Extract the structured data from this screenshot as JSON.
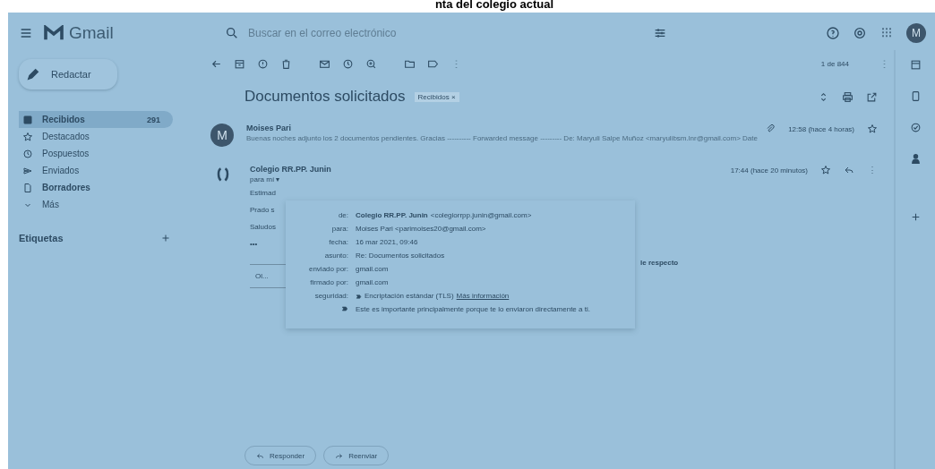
{
  "caption": "nta del colegio actual",
  "topbar": {
    "product": "Gmail",
    "search_placeholder": "Buscar en el correo electrónico",
    "avatar": "M"
  },
  "sidebar": {
    "compose": "Redactar",
    "items": [
      {
        "label": "Recibidos",
        "count": "291",
        "bold": true,
        "selected": true
      },
      {
        "label": "Destacados",
        "bold": false,
        "selected": false
      },
      {
        "label": "Pospuestos",
        "bold": false,
        "selected": false
      },
      {
        "label": "Enviados",
        "bold": false,
        "selected": false
      },
      {
        "label": "Borradores",
        "bold": true,
        "selected": false
      },
      {
        "label": "Más",
        "bold": false,
        "selected": false
      }
    ],
    "labels_heading": "Etiquetas"
  },
  "toolbar": {
    "pager": "1 de 844"
  },
  "thread": {
    "subject": "Documentos solicitados",
    "chip": "Recibidos ×",
    "messages": [
      {
        "kind": "letter",
        "avatar": "M",
        "sender": "Moises Pari",
        "snippet": "Buenas noches adjunto los 2 documentos pendientes. Gracias ---------- Forwarded message --------- De: Maryuli Salpe Muñoz <maryulibsm.lnr@gmail.com> Date",
        "time": "12:58 (hace 4 horas)",
        "attachment": true,
        "expanded": false
      },
      {
        "kind": "crest",
        "sender": "Colegio RR.PP. Junin",
        "to": "para mí ▾",
        "time": "17:44 (hace 20 minutos)",
        "attachment": false,
        "expanded": true,
        "body": [
          "Estimad",
          "Prado s",
          "Saludos",
          "•••"
        ],
        "aside": "le respecto",
        "file": "Ol..."
      }
    ]
  },
  "details": [
    {
      "label": "de:",
      "value": "**Colegio RR.PP. Junin** <colegiorrpp.junin@gmail.com>"
    },
    {
      "label": "para:",
      "value": "Moises Pari <parimoises20@gmail.com>"
    },
    {
      "label": "fecha:",
      "value": "16 mar 2021, 09:46"
    },
    {
      "label": "asunto:",
      "value": "Re: Documentos solicitados"
    },
    {
      "label": "enviado por:",
      "value": "gmail.com"
    },
    {
      "label": "firmado por:",
      "value": "gmail.com"
    },
    {
      "label": "seguridad:",
      "value": "Encriptación estándar (TLS)",
      "link": "Más información"
    },
    {
      "value": "Este es importante principalmente porque te lo enviaron directamente a ti."
    }
  ],
  "actions": [
    "Responder",
    "Reenviar"
  ]
}
